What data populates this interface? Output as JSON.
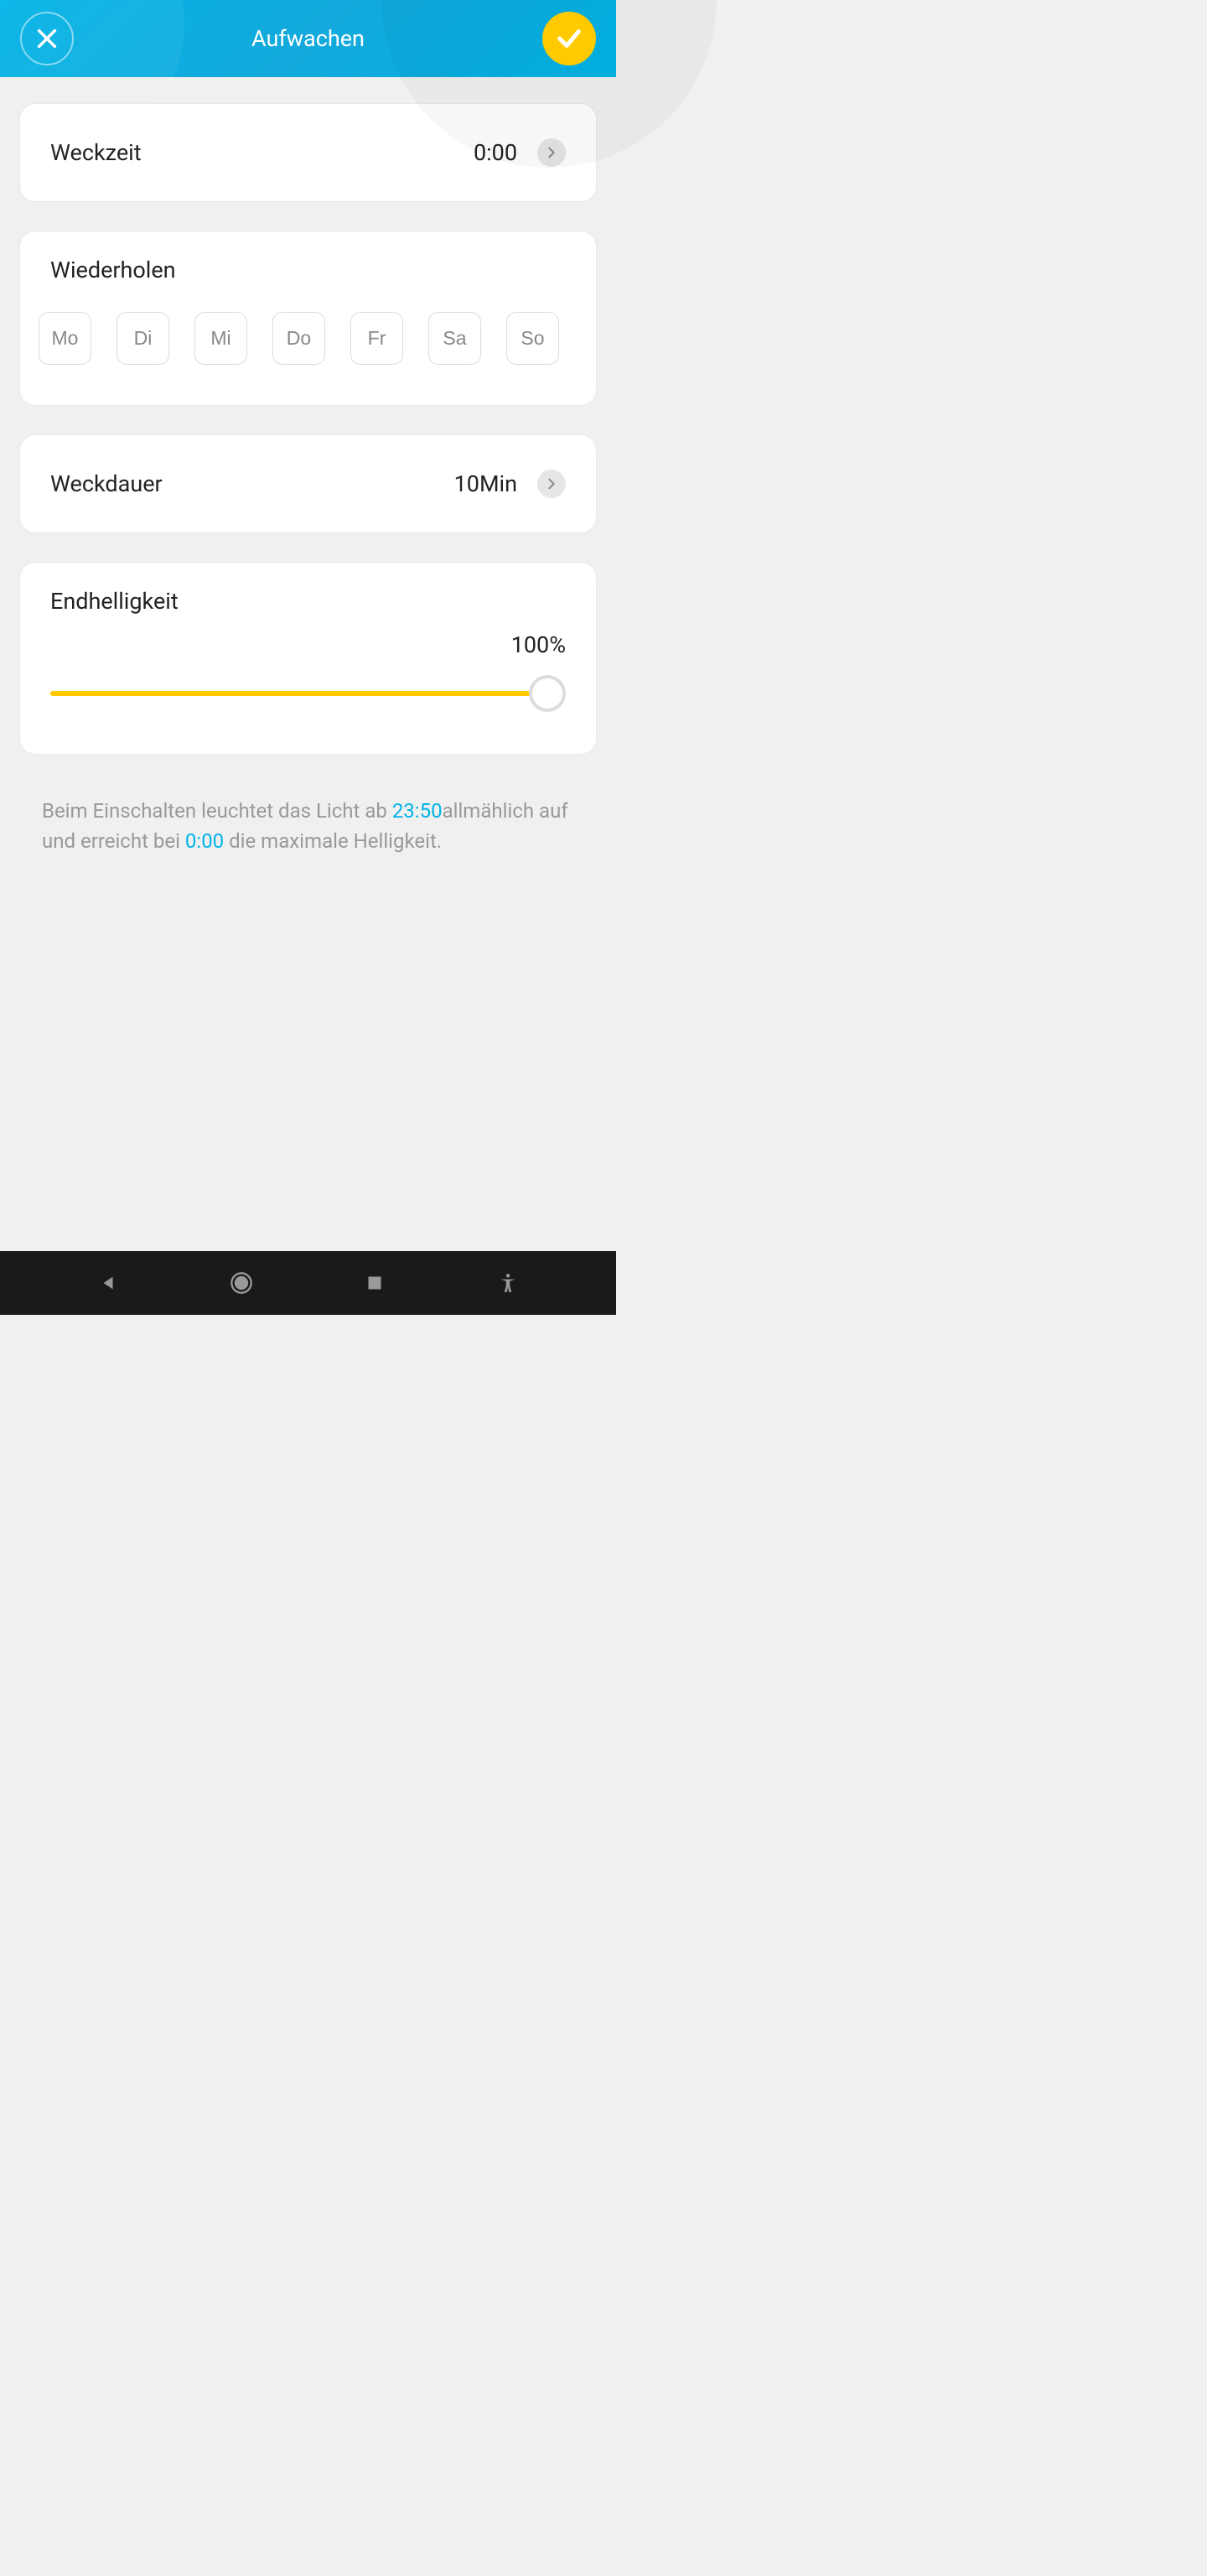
{
  "header": {
    "title": "Aufwachen"
  },
  "wakeTime": {
    "label": "Weckzeit",
    "value": "0:00"
  },
  "repeat": {
    "label": "Wiederholen",
    "days": [
      "Mo",
      "Di",
      "Mi",
      "Do",
      "Fr",
      "Sa",
      "So"
    ]
  },
  "duration": {
    "label": "Weckdauer",
    "value": "10Min"
  },
  "brightness": {
    "label": "Endhelligkeit",
    "value": "100%"
  },
  "footer": {
    "part1": "Beim Einschalten leuchtet das Licht ab ",
    "time1": "23:50",
    "part2": "allmählich auf und erreicht bei ",
    "time2": "0:00",
    "part3": " die maximale Helligkeit."
  }
}
